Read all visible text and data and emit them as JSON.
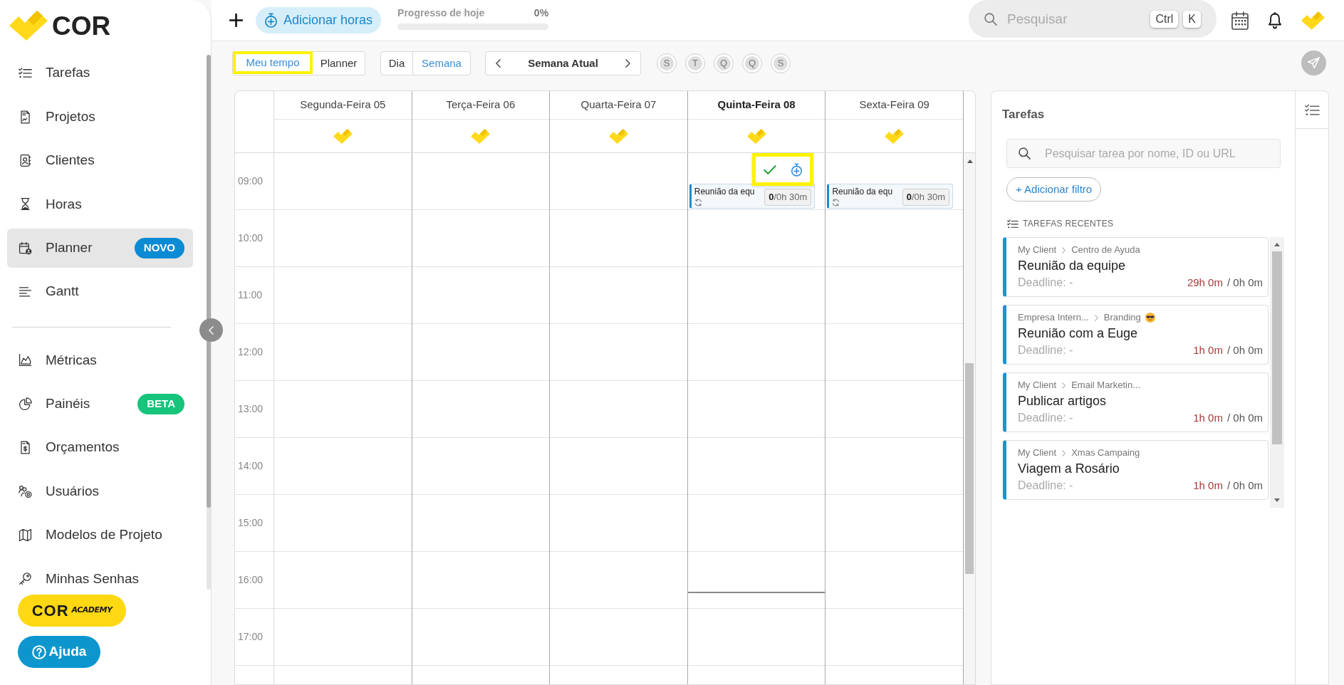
{
  "sidebar": {
    "logo_text": "COR",
    "nav_items": [
      {
        "label": "Tarefas",
        "selected": false
      },
      {
        "label": "Projetos",
        "selected": false
      },
      {
        "label": "Clientes",
        "selected": false
      },
      {
        "label": "Horas",
        "selected": false
      },
      {
        "label": "Planner",
        "selected": true,
        "badge": {
          "text": "NOVO",
          "color": "#0a8bd3"
        }
      },
      {
        "label": "Gantt",
        "selected": false
      }
    ],
    "secondary_items": [
      {
        "label": "Métricas",
        "selected": false
      },
      {
        "label": "Painéis",
        "selected": false,
        "badge": {
          "text": "BETA",
          "color": "#17c47c"
        }
      },
      {
        "label": "Orçamentos",
        "selected": false
      },
      {
        "label": "Usuários",
        "selected": false
      },
      {
        "label": "Modelos de Projeto",
        "selected": false
      },
      {
        "label": "Minhas Senhas",
        "selected": false
      }
    ],
    "buttons": [
      {
        "kind": "academy",
        "label": "COR",
        "sublabel": "ACADEMY"
      },
      {
        "kind": "help",
        "label": "Ajuda"
      }
    ]
  },
  "top_bar": {
    "add_hours_button": "Adicionar horas",
    "progress": {
      "label": "Progresso de hoje",
      "value": "0%",
      "level": 0
    },
    "search": {
      "placeholder": "Pesquisar",
      "keys": [
        "Ctrl",
        "K"
      ]
    }
  },
  "toolbar": {
    "view_tabs": [
      {
        "label": "Meu tempo",
        "selected": true,
        "highlighted": true
      },
      {
        "label": "Planner",
        "selected": false,
        "highlighted": false
      }
    ],
    "range_tabs": [
      {
        "label": "Dia",
        "selected": false
      },
      {
        "label": "Semana",
        "selected": true
      }
    ],
    "week_nav": {
      "label": "Semana Atual"
    },
    "day_filters": [
      {
        "label": "S"
      },
      {
        "label": "T"
      },
      {
        "label": "Q"
      },
      {
        "label": "Q"
      },
      {
        "label": "S"
      }
    ]
  },
  "calendar": {
    "days": [
      {
        "label": "Segunda-Feira 05",
        "today": false
      },
      {
        "label": "Terça-Feira 06",
        "today": false
      },
      {
        "label": "Quarta-Feira 07",
        "today": false
      },
      {
        "label": "Quinta-Feira 08",
        "today": true
      },
      {
        "label": "Sexta-Feira 09",
        "today": false
      }
    ],
    "time_rows": [
      {
        "time": "09:00",
        "cells": [
          {},
          {},
          {},
          {
            "events": [
              {
                "title": "Reunião da equ",
                "time": "**0**/0h 30m",
                "recurring": true,
                "actions": {
                  "highlighted": true
                }
              }
            ]
          },
          {
            "events": [
              {
                "title": "Reunião da equ",
                "time": "**0**/0h 30m",
                "recurring": true
              }
            ]
          }
        ]
      },
      {
        "time": "10:00"
      },
      {
        "time": "11:00"
      },
      {
        "time": "12:00"
      },
      {
        "time": "13:00"
      },
      {
        "time": "14:00"
      },
      {
        "time": "15:00"
      },
      {
        "time": "16:00"
      },
      {
        "time": "17:00"
      }
    ]
  },
  "tasks_panel": {
    "title": "Tarefas",
    "search": {
      "placeholder": "Pesquisar tarea por nome, ID ou URL"
    },
    "filter_button": "+ Adicionar filtro",
    "section_title": "TAREFAS RECENTES",
    "cards": [
      {
        "client": "My Client",
        "project": "Centro de Ayuda",
        "project_icon": false,
        "title": "Reunião da equipe",
        "deadline": "Deadline: -",
        "spent": "29h 0m",
        "planned": "/ 0h 0m"
      },
      {
        "client": "Empresa Intern...",
        "project": "Branding",
        "project_icon": true,
        "title": "Reunião com a Euge",
        "deadline": "Deadline: -",
        "spent": "1h 0m",
        "planned": "/ 0h 0m"
      },
      {
        "client": "My Client",
        "project": "Email Marketin...",
        "project_icon": false,
        "title": "Publicar artigos",
        "deadline": "Deadline: -",
        "spent": "1h 0m",
        "planned": "/ 0h 0m"
      },
      {
        "client": "My Client",
        "project": "Xmas Campaing",
        "project_icon": false,
        "title": "Viagem a Rosário",
        "deadline": "Deadline: -",
        "spent": "1h 0m",
        "planned": "/ 0h 0m"
      }
    ]
  }
}
